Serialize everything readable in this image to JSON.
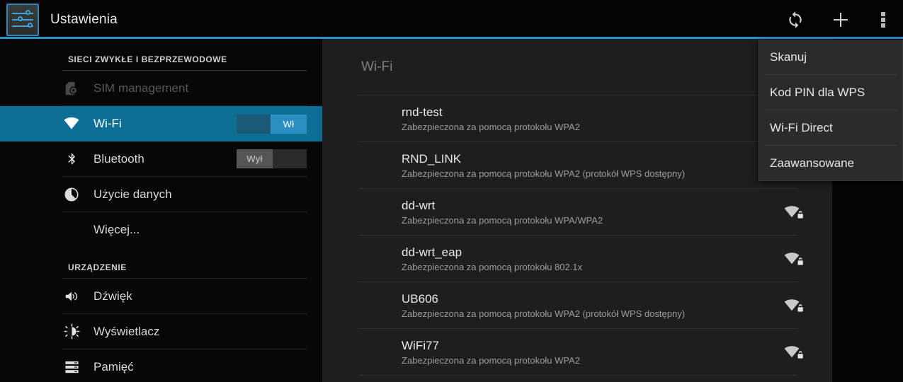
{
  "actionbar": {
    "title": "Ustawienia",
    "app_icon": "settings-sliders-icon",
    "actions": [
      {
        "name": "sync-refresh-icon",
        "label": "Sync"
      },
      {
        "name": "add-icon",
        "label": "Add"
      },
      {
        "name": "overflow-menu-icon",
        "label": "More options"
      }
    ]
  },
  "overflow_menu": {
    "items": [
      {
        "label": "Skanuj"
      },
      {
        "label": "Kod PIN dla WPS"
      },
      {
        "label": "Wi-Fi Direct"
      },
      {
        "label": "Zaawansowane"
      }
    ]
  },
  "sidebar": {
    "sections": [
      {
        "header": "SIECI ZWYKŁE I BEZPRZEWODOWE",
        "items": [
          {
            "label": "SIM management",
            "icon": "sim-card-icon",
            "state": "disabled",
            "toggle": null
          },
          {
            "label": "Wi-Fi",
            "icon": "wifi-icon",
            "state": "selected",
            "toggle": {
              "value": "Wł",
              "on": true
            }
          },
          {
            "label": "Bluetooth",
            "icon": "bluetooth-icon",
            "state": "normal",
            "toggle": {
              "value": "Wył",
              "on": false
            }
          },
          {
            "label": "Użycie danych",
            "icon": "data-usage-pie-icon",
            "state": "normal",
            "toggle": null
          },
          {
            "label": "Więcej...",
            "icon": null,
            "state": "normal",
            "toggle": null
          }
        ]
      },
      {
        "header": "URZĄDZENIE",
        "items": [
          {
            "label": "Dźwięk",
            "icon": "sound-speaker-icon",
            "state": "normal",
            "toggle": null
          },
          {
            "label": "Wyświetlacz",
            "icon": "display-brightness-icon",
            "state": "normal",
            "toggle": null
          },
          {
            "label": "Pamięć",
            "icon": "storage-icon",
            "state": "normal",
            "toggle": null
          }
        ]
      }
    ]
  },
  "content": {
    "title": "Wi-Fi",
    "networks": [
      {
        "ssid": "rnd-test",
        "security": "Zabezpieczona za pomocą protokołu WPA2",
        "signal_icon": false
      },
      {
        "ssid": "RND_LINK",
        "security": "Zabezpieczona za pomocą protokołu WPA2 (protokół WPS dostępny)",
        "signal_icon": false
      },
      {
        "ssid": "dd-wrt",
        "security": "Zabezpieczona za pomocą protokołu WPA/WPA2",
        "signal_icon": true
      },
      {
        "ssid": "dd-wrt_eap",
        "security": "Zabezpieczona za pomocą protokołu 802.1x",
        "signal_icon": true
      },
      {
        "ssid": "UB606",
        "security": "Zabezpieczona za pomocą protokołu WPA2 (protokół WPS dostępny)",
        "signal_icon": true
      },
      {
        "ssid": "WiFi77",
        "security": "Zabezpieczona za pomocą protokołu WPA2",
        "signal_icon": true
      }
    ]
  },
  "colors": {
    "accent_blue": "#2a93c9",
    "selected_row": "#0d6f96",
    "switch_on": "#2b8fc4",
    "content_bg": "#1e1e1e",
    "sidebar_bg": "#070707"
  }
}
